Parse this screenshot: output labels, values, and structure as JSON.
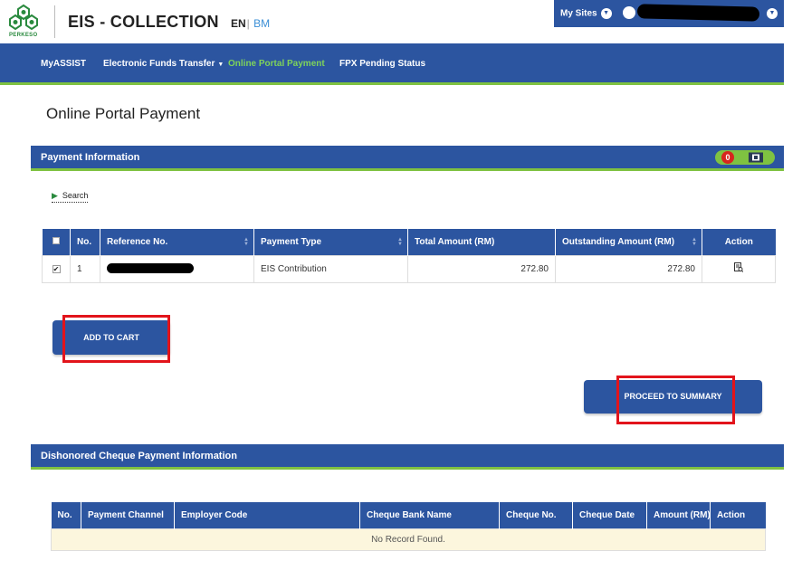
{
  "header": {
    "logo_text": "PERKESO",
    "app_title": "EIS - COLLECTION",
    "lang_en": "EN",
    "lang_sep": "|",
    "lang_bm": "BM",
    "my_sites": "My Sites"
  },
  "nav": {
    "items": [
      {
        "label": "MyASSIST"
      },
      {
        "label": "Electronic Funds Transfer"
      },
      {
        "label": "Online Portal Payment"
      },
      {
        "label": "FPX Pending Status"
      }
    ]
  },
  "page_title": "Online Portal Payment",
  "payment_panel": {
    "title": "Payment Information",
    "cart_count": "0",
    "search_label": "Search",
    "columns": [
      "No.",
      "Reference No.",
      "Payment Type",
      "Total Amount (RM)",
      "Outstanding Amount (RM)",
      "Action"
    ],
    "rows": [
      {
        "no": "1",
        "payment_type": "EIS Contribution",
        "total": "272.80",
        "outstanding": "272.80"
      }
    ]
  },
  "buttons": {
    "add_to_cart": "ADD TO CART",
    "proceed": "PROCEED TO SUMMARY"
  },
  "dishonored_panel": {
    "title": "Dishonored Cheque Payment Information",
    "columns": [
      "No.",
      "Payment Channel",
      "Employer Code",
      "Cheque Bank Name",
      "Cheque No.",
      "Cheque Date",
      "Amount (RM)",
      "Action"
    ],
    "empty_text": "No Record Found."
  },
  "colors": {
    "primary": "#2c55a0",
    "accent_green": "#7fc241",
    "highlight_red": "#e2141b",
    "badge_red": "#d7261e"
  }
}
